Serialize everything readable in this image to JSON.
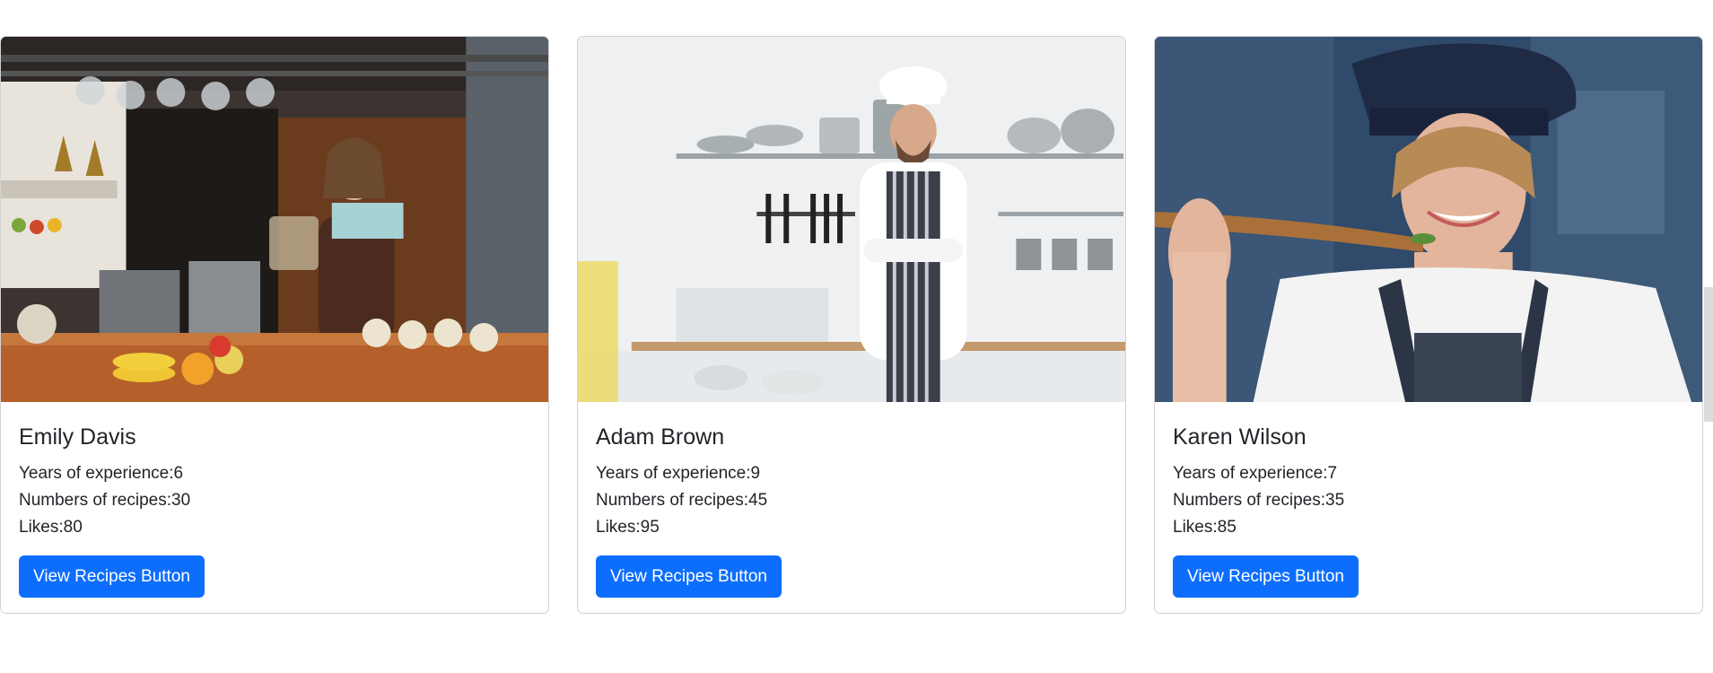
{
  "cards": [
    {
      "image_alt": "chef-pouring-drink-photo",
      "name": "Emily Davis",
      "experience_label": "Years of experience:",
      "experience": "6",
      "recipes_label": "Numbers of recipes:",
      "recipes": "30",
      "likes_label": "Likes:",
      "likes": "80",
      "button_label": "View Recipes Button"
    },
    {
      "image_alt": "chef-kitchen-arms-crossed-photo",
      "name": "Adam Brown",
      "experience_label": "Years of experience:",
      "experience": "9",
      "recipes_label": "Numbers of recipes:",
      "recipes": "45",
      "likes_label": "Likes:",
      "likes": "95",
      "button_label": "View Recipes Button"
    },
    {
      "image_alt": "chef-with-wooden-spoon-photo",
      "name": "Karen Wilson",
      "experience_label": "Years of experience:",
      "experience": "7",
      "recipes_label": "Numbers of recipes:",
      "recipes": "35",
      "likes_label": "Likes:",
      "likes": "85",
      "button_label": "View Recipes Button"
    }
  ],
  "colors": {
    "button": "#0d6efd",
    "button_text": "#ffffff",
    "text": "#212529"
  }
}
